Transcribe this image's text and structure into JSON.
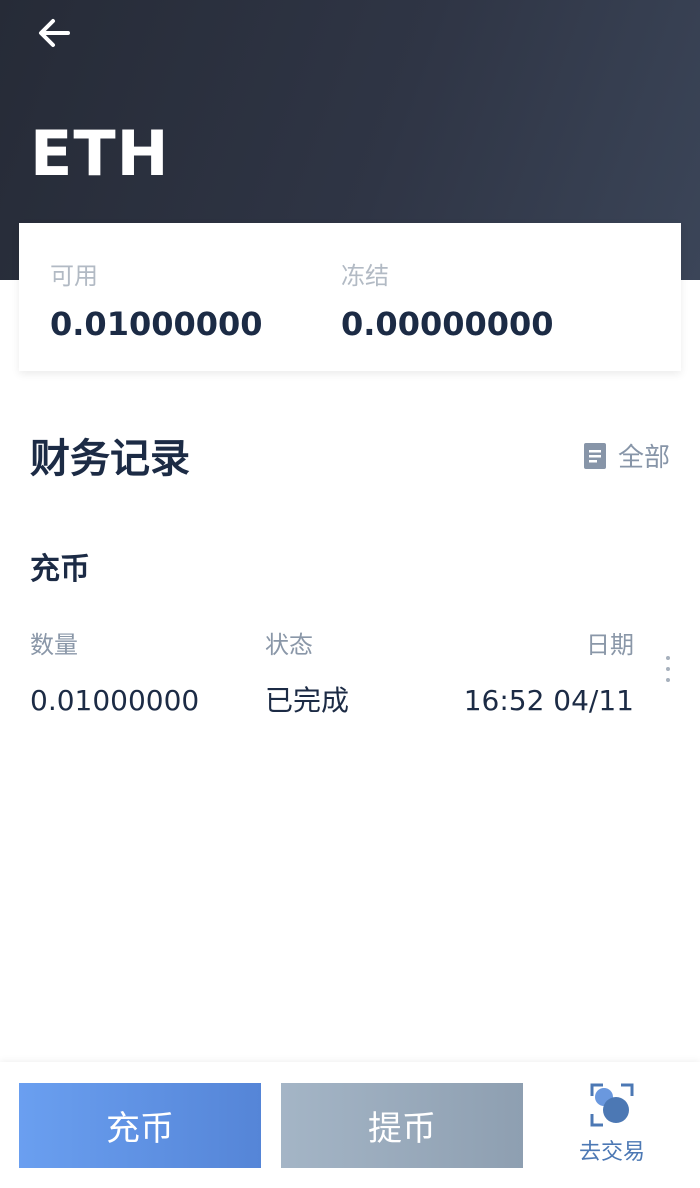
{
  "header": {
    "back_icon": "arrow-left-icon",
    "title": "ETH"
  },
  "balance": {
    "available_label": "可用",
    "available_value": "0.01000000",
    "frozen_label": "冻结",
    "frozen_value": "0.00000000"
  },
  "records": {
    "title": "财务记录",
    "filter_icon": "document-icon",
    "filter_label": "全部",
    "type_title": "充币",
    "columns": {
      "quantity": "数量",
      "status": "状态",
      "date": "日期"
    },
    "rows": [
      {
        "quantity": "0.01000000",
        "status": "已完成",
        "date": "16:52 04/11"
      }
    ],
    "more_icon": "vertical-ellipsis-icon"
  },
  "bottom": {
    "deposit_label": "充币",
    "withdraw_label": "提币",
    "trade_icon": "exchange-icon",
    "trade_label": "去交易"
  },
  "colors": {
    "header_bg": "#2b3140",
    "primary_text": "#1c2b45",
    "deposit_button": "#5d8fe0",
    "withdraw_button": "#9aabbd",
    "trade_accent": "#4c78b4"
  }
}
